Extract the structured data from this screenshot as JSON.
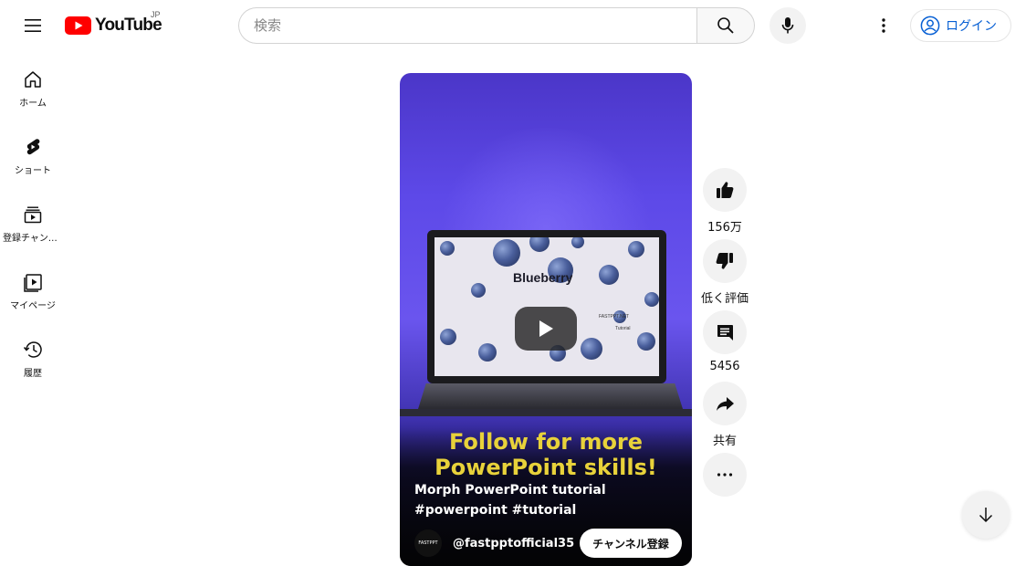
{
  "header": {
    "logo_text": "YouTube",
    "logo_country": "JP",
    "search_placeholder": "検索",
    "login_label": "ログイン"
  },
  "sidebar": {
    "items": [
      {
        "label": "ホーム",
        "icon": "home-icon"
      },
      {
        "label": "ショート",
        "icon": "shorts-icon"
      },
      {
        "label": "登録チャンネル",
        "icon": "subscriptions-icon"
      },
      {
        "label": "マイページ",
        "icon": "library-icon"
      },
      {
        "label": "履歴",
        "icon": "history-icon"
      }
    ]
  },
  "video": {
    "slide_title": "Blueberry",
    "slide_brand": "FASTPPT.NET",
    "slide_caption": "Tutorial",
    "overlay_text": "Follow for more PowerPoint skills!",
    "title": "Morph PowerPoint tutorial #powerpoint #tutorial",
    "channel": "@fastpptofficial35",
    "avatar_text": "FASTPPT",
    "subscribe_label": "チャンネル登録"
  },
  "actions": {
    "like_count": "156万",
    "dislike_label": "低く評価",
    "comment_count": "5456",
    "share_label": "共有"
  },
  "colors": {
    "brand_red": "#ff0000",
    "link_blue": "#065fd4",
    "overlay_yellow": "#e8d23a"
  }
}
